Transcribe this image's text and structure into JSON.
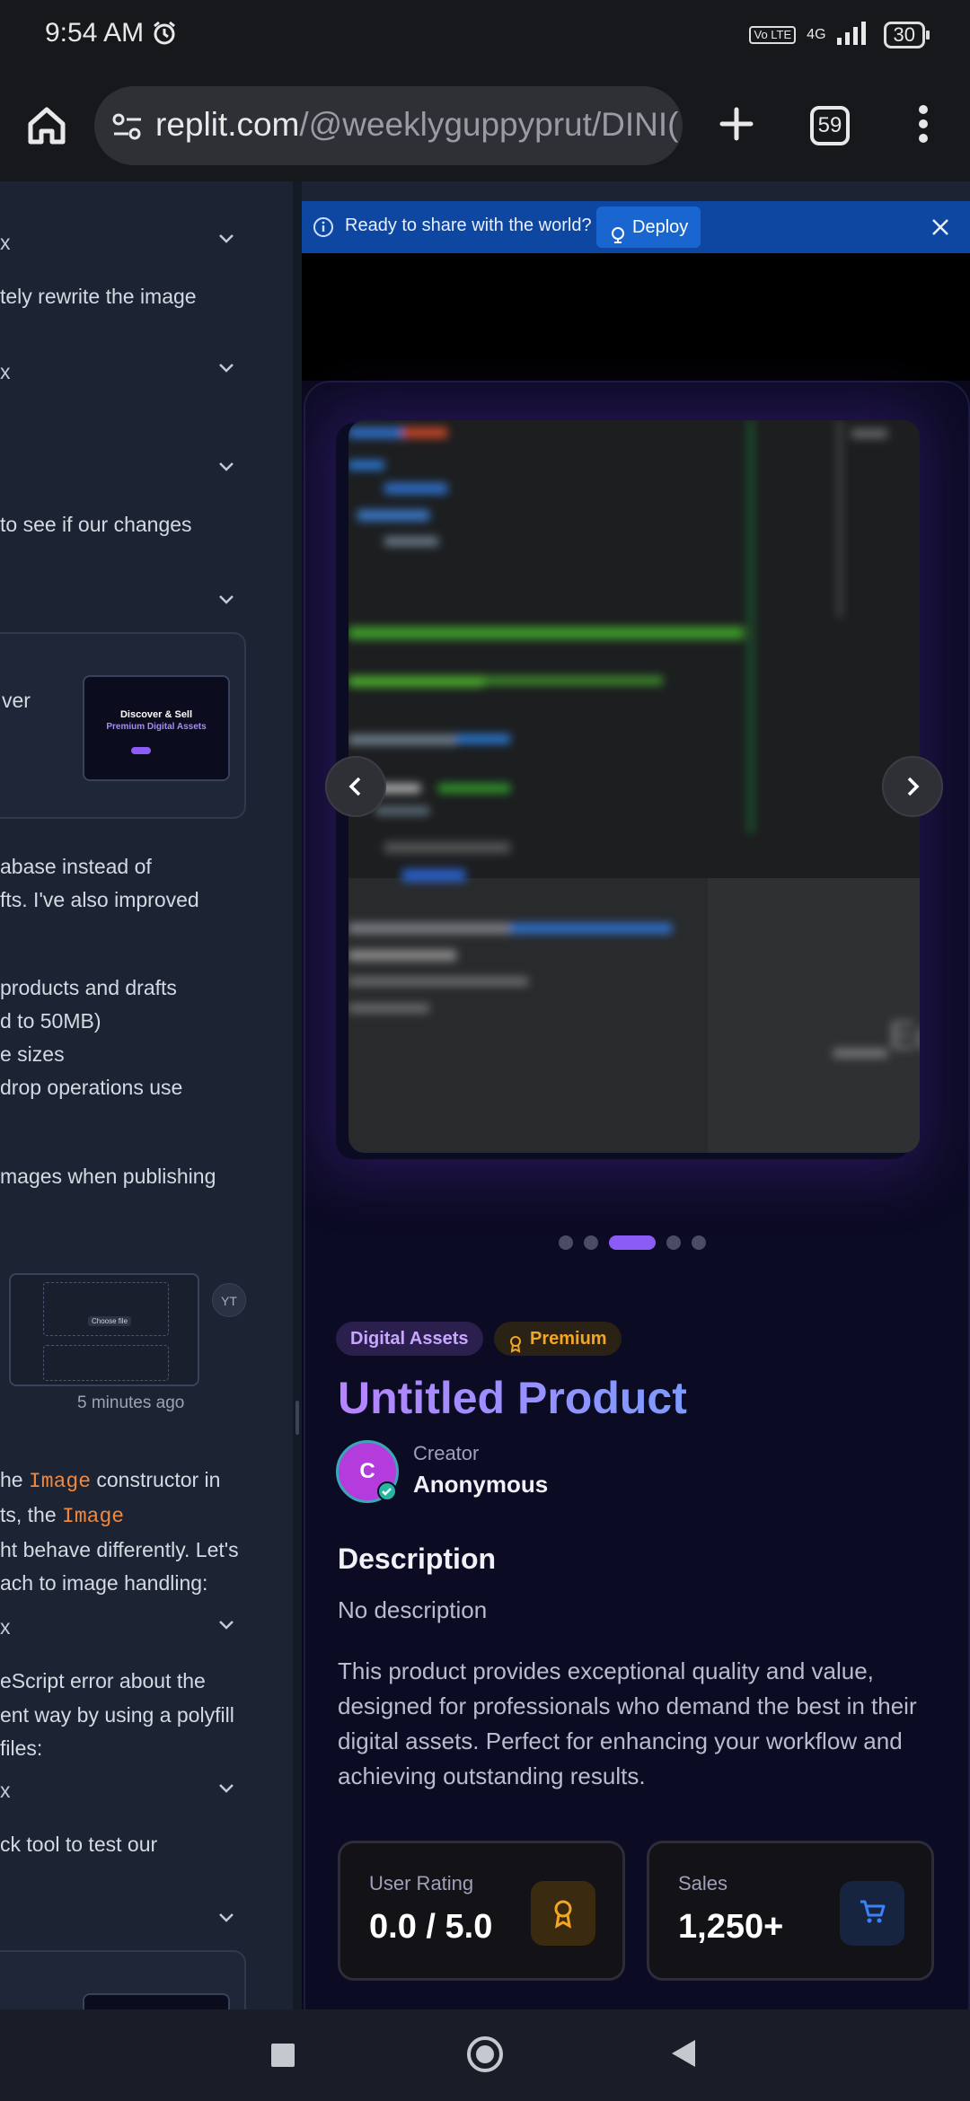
{
  "status_bar": {
    "time": "9:54 AM",
    "volte": "Vo LTE",
    "network": "4G",
    "battery": "30"
  },
  "browser": {
    "url_host": "replit.com",
    "url_path": "/@weeklyguppyprut/DINI(",
    "tab_count": "59"
  },
  "chat": {
    "lines": [
      {
        "text": "x"
      },
      {
        "text": "tely rewrite the image"
      },
      {
        "text": "x"
      },
      {
        "text": "to see if our changes"
      },
      {
        "text": "ver"
      },
      {
        "text": "abase instead of"
      },
      {
        "text": "fts. I've also improved"
      },
      {
        "text": "products and drafts"
      },
      {
        "text": "d to 50MB)"
      },
      {
        "text": "e sizes"
      },
      {
        "text": "drop operations use"
      },
      {
        "text": "mages when publishing"
      },
      {
        "text": "5 minutes ago"
      },
      {
        "text": "he"
      },
      {
        "text": "Image"
      },
      {
        "text": "constructor in"
      },
      {
        "text": "ts, the"
      },
      {
        "text": "Image"
      },
      {
        "text": "ht behave differently. Let's"
      },
      {
        "text": "ach to image handling:"
      },
      {
        "text": "x"
      },
      {
        "text": "eScript error about the"
      },
      {
        "text": "ent way by using a polyfill"
      },
      {
        "text": "files:"
      },
      {
        "text": "x"
      },
      {
        "text": "ck tool to test our"
      }
    ],
    "avatar_initials": "YT",
    "thumb_heading_1": "Discover & Sell",
    "thumb_heading_2": "Premium Digital Assets",
    "thumb_upload_btn": "Choose file"
  },
  "preview": {
    "deploy_message": "Ready to share with the world?",
    "deploy_button": "Deploy",
    "carousel": {
      "slides": 5,
      "active_index": 2
    },
    "image_corner_text": "Ec",
    "tags": [
      "Digital Assets",
      "Premium"
    ],
    "title": "Untitled Product",
    "creator_initial": "C",
    "creator_label": "Creator",
    "creator_name": "Anonymous",
    "description_heading": "Description",
    "description_short": "No description",
    "description_long": "This product provides exceptional quality and value, designed for professionals who demand the best in their digital assets. Perfect for enhancing your workflow and achieving outstanding results.",
    "stats": [
      {
        "label": "User Rating",
        "value": "0.0 / 5.0",
        "icon": "award-icon",
        "accent": "#f5a524"
      },
      {
        "label": "Sales",
        "value": "1,250+",
        "icon": "cart-icon",
        "accent": "#3b82f6"
      }
    ]
  },
  "colors": {
    "title_gradient_start": "#b784ff",
    "title_gradient_end": "#7c9bff",
    "accent_purple": "#8b5cf6",
    "deploy_bar": "#0d47a1"
  }
}
